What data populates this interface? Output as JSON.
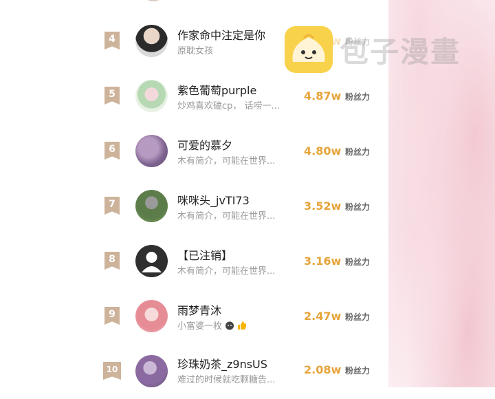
{
  "watermark": {
    "text": "包子漫畫"
  },
  "fans_label": "粉丝力",
  "rows": [
    {
      "rank": "4",
      "name": "作家命中注定是你",
      "desc": "原耽女孩",
      "fans": "4.84w"
    },
    {
      "rank": "5",
      "name": "紫色葡萄purple",
      "desc": "炒鸡喜欢磕cp， 话唠一...",
      "fans": "4.87w"
    },
    {
      "rank": "6",
      "name": "可爱的慕夕",
      "desc": "木有简介，可能在世界...",
      "fans": "4.80w"
    },
    {
      "rank": "7",
      "name": "咪咪头_jvTI73",
      "desc": "木有简介，可能在世界...",
      "fans": "3.52w"
    },
    {
      "rank": "8",
      "name": "【已注销】",
      "desc": "木有简介，可能在世界...",
      "fans": "3.16w"
    },
    {
      "rank": "9",
      "name": "雨梦青沐",
      "desc": "小富婆一枚",
      "fans": "2.47w"
    },
    {
      "rank": "10",
      "name": "珍珠奶茶_z9nsUS",
      "desc": "难过的时候就吃颗糖告...",
      "fans": "2.08w"
    }
  ],
  "colors": {
    "accent": "#e6a43a",
    "badge": "#cdb39a"
  }
}
